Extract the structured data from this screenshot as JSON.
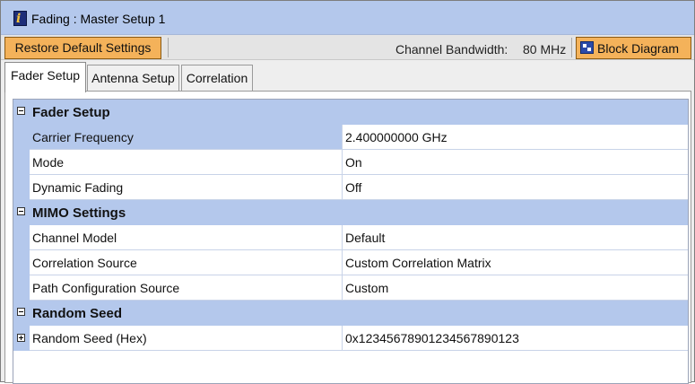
{
  "window": {
    "title": "Fading : Master Setup 1",
    "title_icon": "info-icon"
  },
  "toolbar": {
    "restore_label": "Restore Default Settings",
    "bandwidth_label": "Channel Bandwidth:",
    "bandwidth_value": "80 MHz",
    "block_diagram_label": "Block Diagram",
    "block_diagram_icon": "block-diagram-icon",
    "button_color": "#f4b25a"
  },
  "tabs": [
    {
      "label": "Fader Setup",
      "active": true
    },
    {
      "label": "Antenna Setup",
      "active": false
    },
    {
      "label": "Correlation",
      "active": false
    }
  ],
  "grid": {
    "category_color": "#b4c8ec",
    "sections": [
      {
        "label": "Fader Setup",
        "expanded": true,
        "rows": [
          {
            "name": "Carrier Frequency",
            "value": "2.400000000 GHz",
            "selected": true
          },
          {
            "name": "Mode",
            "value": "On"
          },
          {
            "name": "Dynamic Fading",
            "value": "Off"
          }
        ]
      },
      {
        "label": "MIMO Settings",
        "expanded": true,
        "rows": [
          {
            "name": "Channel Model",
            "value": "Default"
          },
          {
            "name": "Correlation Source",
            "value": "Custom Correlation Matrix"
          },
          {
            "name": "Path Configuration Source",
            "value": "Custom"
          }
        ]
      },
      {
        "label": "Random Seed",
        "expanded": true,
        "rows": [
          {
            "name": "Random Seed (Hex)",
            "value": "0x12345678901234567890123",
            "expandable": true
          }
        ]
      }
    ]
  }
}
